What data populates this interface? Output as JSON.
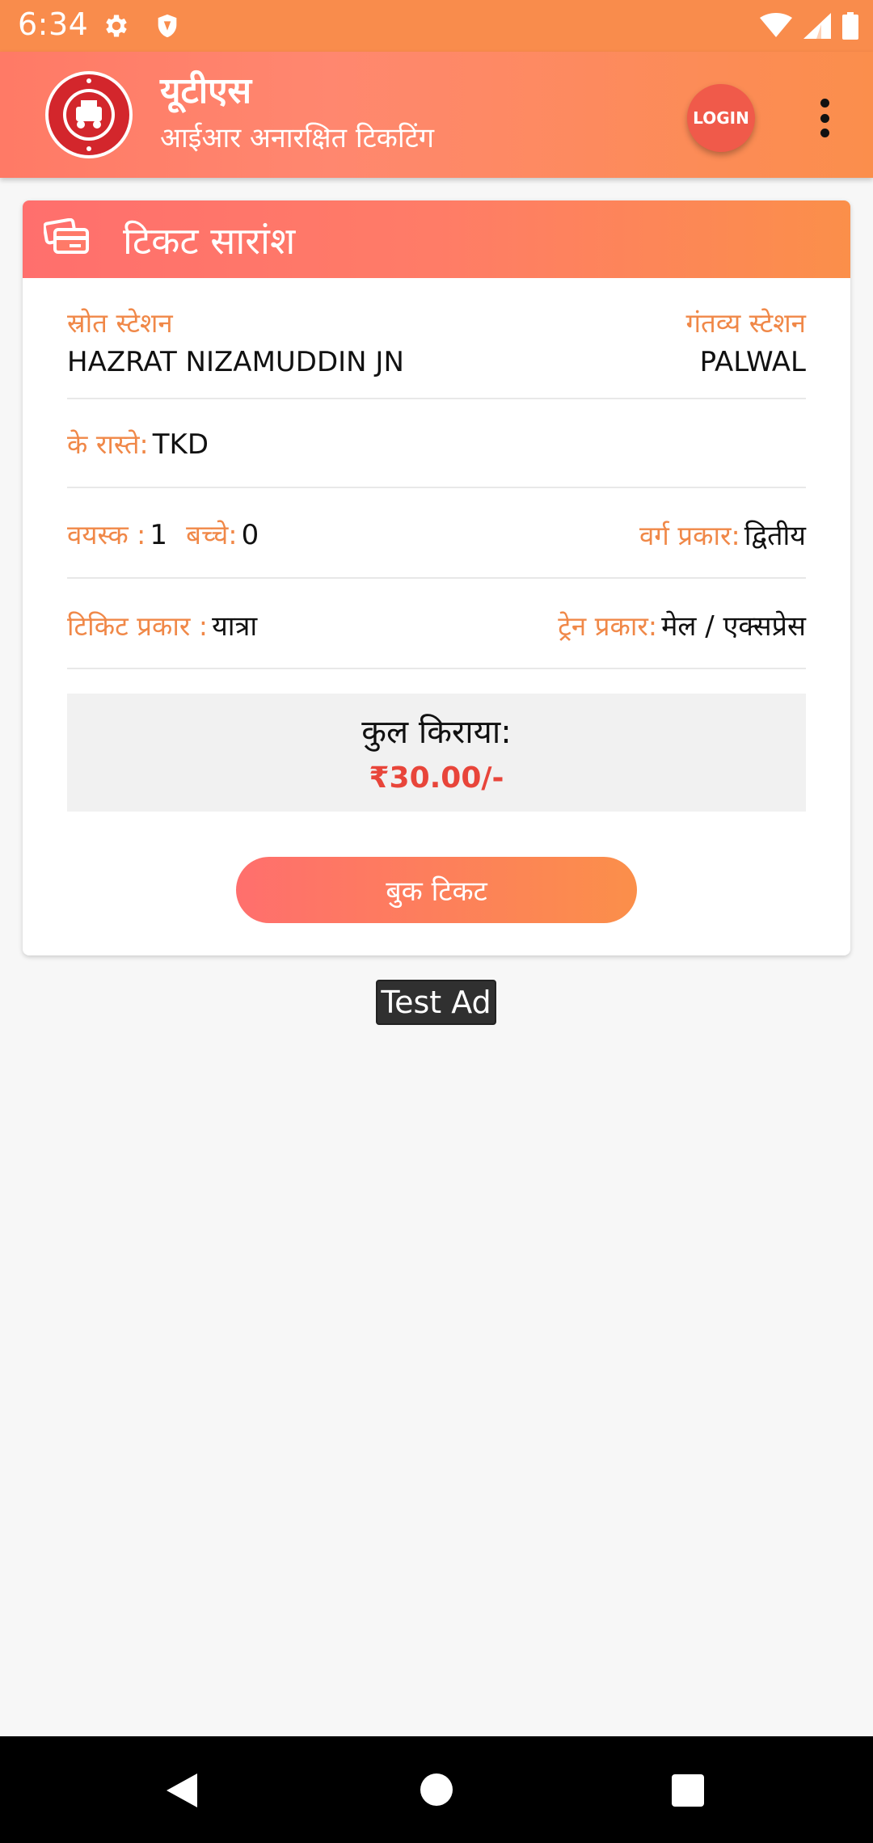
{
  "status_bar": {
    "time": "6:34"
  },
  "app_bar": {
    "title": "यूटीएस",
    "subtitle": "आईआर अनारक्षित टिकटिंग",
    "login_label": "LOGIN"
  },
  "ticket_summary": {
    "title": "टिकट सारांश",
    "source_label": "स्रोत स्टेशन",
    "source_value": "HAZRAT NIZAMUDDIN JN",
    "destination_label": "गंतव्य स्टेशन",
    "destination_value": "PALWAL",
    "via_label": "के रास्ते:",
    "via_value": "TKD",
    "adult_label": "वयस्क :",
    "adult_value": "1",
    "child_label": "बच्चे:",
    "child_value": "0",
    "class_label": "वर्ग प्रकार:",
    "class_value": "द्वितीय",
    "ticket_type_label": "टिकिट प्रकार :",
    "ticket_type_value": "यात्रा",
    "train_type_label": "ट्रेन प्रकार:",
    "train_type_value": "मेल / एक्सप्रेस",
    "fare_label": "कुल किराया:",
    "fare_value": "₹30.00/-",
    "book_label": "बुक टिकट"
  },
  "ad": {
    "label": "Test Ad"
  },
  "colors": {
    "accent_orange": "#f98c4c",
    "accent_coral": "#ff6f6d",
    "label_orange": "#f08848",
    "fare_red": "#e8453a"
  }
}
